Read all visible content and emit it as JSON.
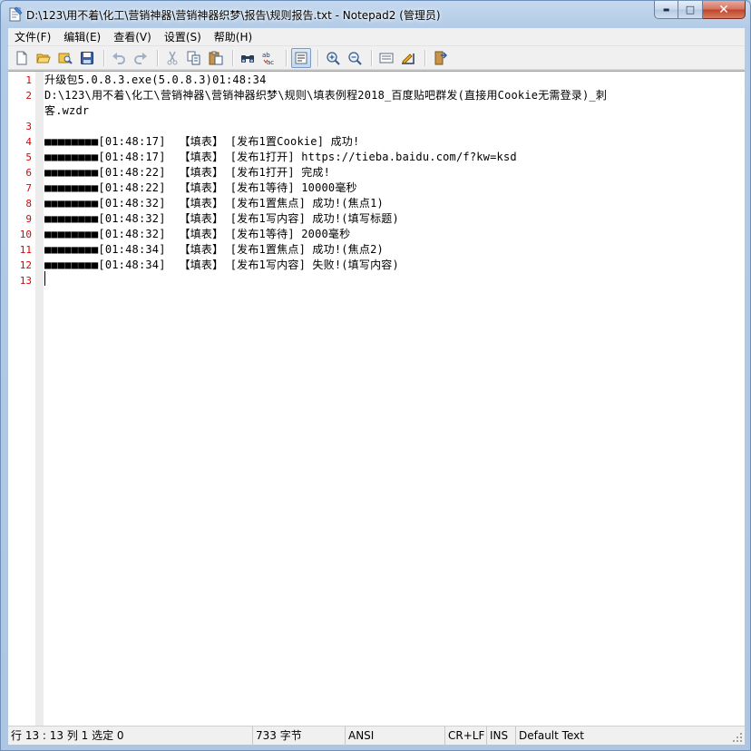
{
  "window": {
    "title": "D:\\123\\用不着\\化工\\营销神器\\营销神器织梦\\报告\\规则报告.txt - Notepad2 (管理员)",
    "min_label": "▬",
    "max_label": "□",
    "close_label": "✕"
  },
  "menu": [
    {
      "label": "文件(F)"
    },
    {
      "label": "编辑(E)"
    },
    {
      "label": "查看(V)"
    },
    {
      "label": "设置(S)"
    },
    {
      "label": "帮助(H)"
    }
  ],
  "toolbar_icons": [
    "new-icon",
    "open-icon",
    "browse-icon",
    "save-icon",
    "undo-icon",
    "redo-icon",
    "cut-icon",
    "copy-icon",
    "paste-icon",
    "find-icon",
    "replace-icon",
    "word-wrap-icon",
    "zoom-in-icon",
    "zoom-out-icon",
    "scheme-icon",
    "customize-icon",
    "exit-icon"
  ],
  "editor": {
    "lines": [
      {
        "num": "1",
        "text": "升级包5.0.8.3.exe(5.0.8.3)01:48:34"
      },
      {
        "num": "2",
        "text": "D:\\123\\用不着\\化工\\营销神器\\营销神器织梦\\规则\\填表例程2018_百度贴吧群发(直接用Cookie无需登录)_刺"
      },
      {
        "num": "",
        "text": "客.wzdr"
      },
      {
        "num": "3",
        "text": ""
      },
      {
        "num": "4",
        "text": "■■■■■■■■[01:48:17]  【填表】 [发布1置Cookie] 成功!"
      },
      {
        "num": "5",
        "text": "■■■■■■■■[01:48:17]  【填表】 [发布1打开] https://tieba.baidu.com/f?kw=ksd"
      },
      {
        "num": "6",
        "text": "■■■■■■■■[01:48:22]  【填表】 [发布1打开] 完成!"
      },
      {
        "num": "7",
        "text": "■■■■■■■■[01:48:22]  【填表】 [发布1等待] 10000毫秒"
      },
      {
        "num": "8",
        "text": "■■■■■■■■[01:48:32]  【填表】 [发布1置焦点] 成功!(焦点1)"
      },
      {
        "num": "9",
        "text": "■■■■■■■■[01:48:32]  【填表】 [发布1写内容] 成功!(填写标题)"
      },
      {
        "num": "10",
        "text": "■■■■■■■■[01:48:32]  【填表】 [发布1等待] 2000毫秒"
      },
      {
        "num": "11",
        "text": "■■■■■■■■[01:48:34]  【填表】 [发布1置焦点] 成功!(焦点2)"
      },
      {
        "num": "12",
        "text": "■■■■■■■■[01:48:34]  【填表】 [发布1写内容] 失败!(填写内容)"
      },
      {
        "num": "13",
        "text": ""
      }
    ]
  },
  "status": {
    "position": "行 13 : 13   列 1   选定 0",
    "size": "733 字节",
    "encoding": "ANSI",
    "eol": "CR+LF",
    "ins": "INS",
    "scheme": "Default Text"
  }
}
